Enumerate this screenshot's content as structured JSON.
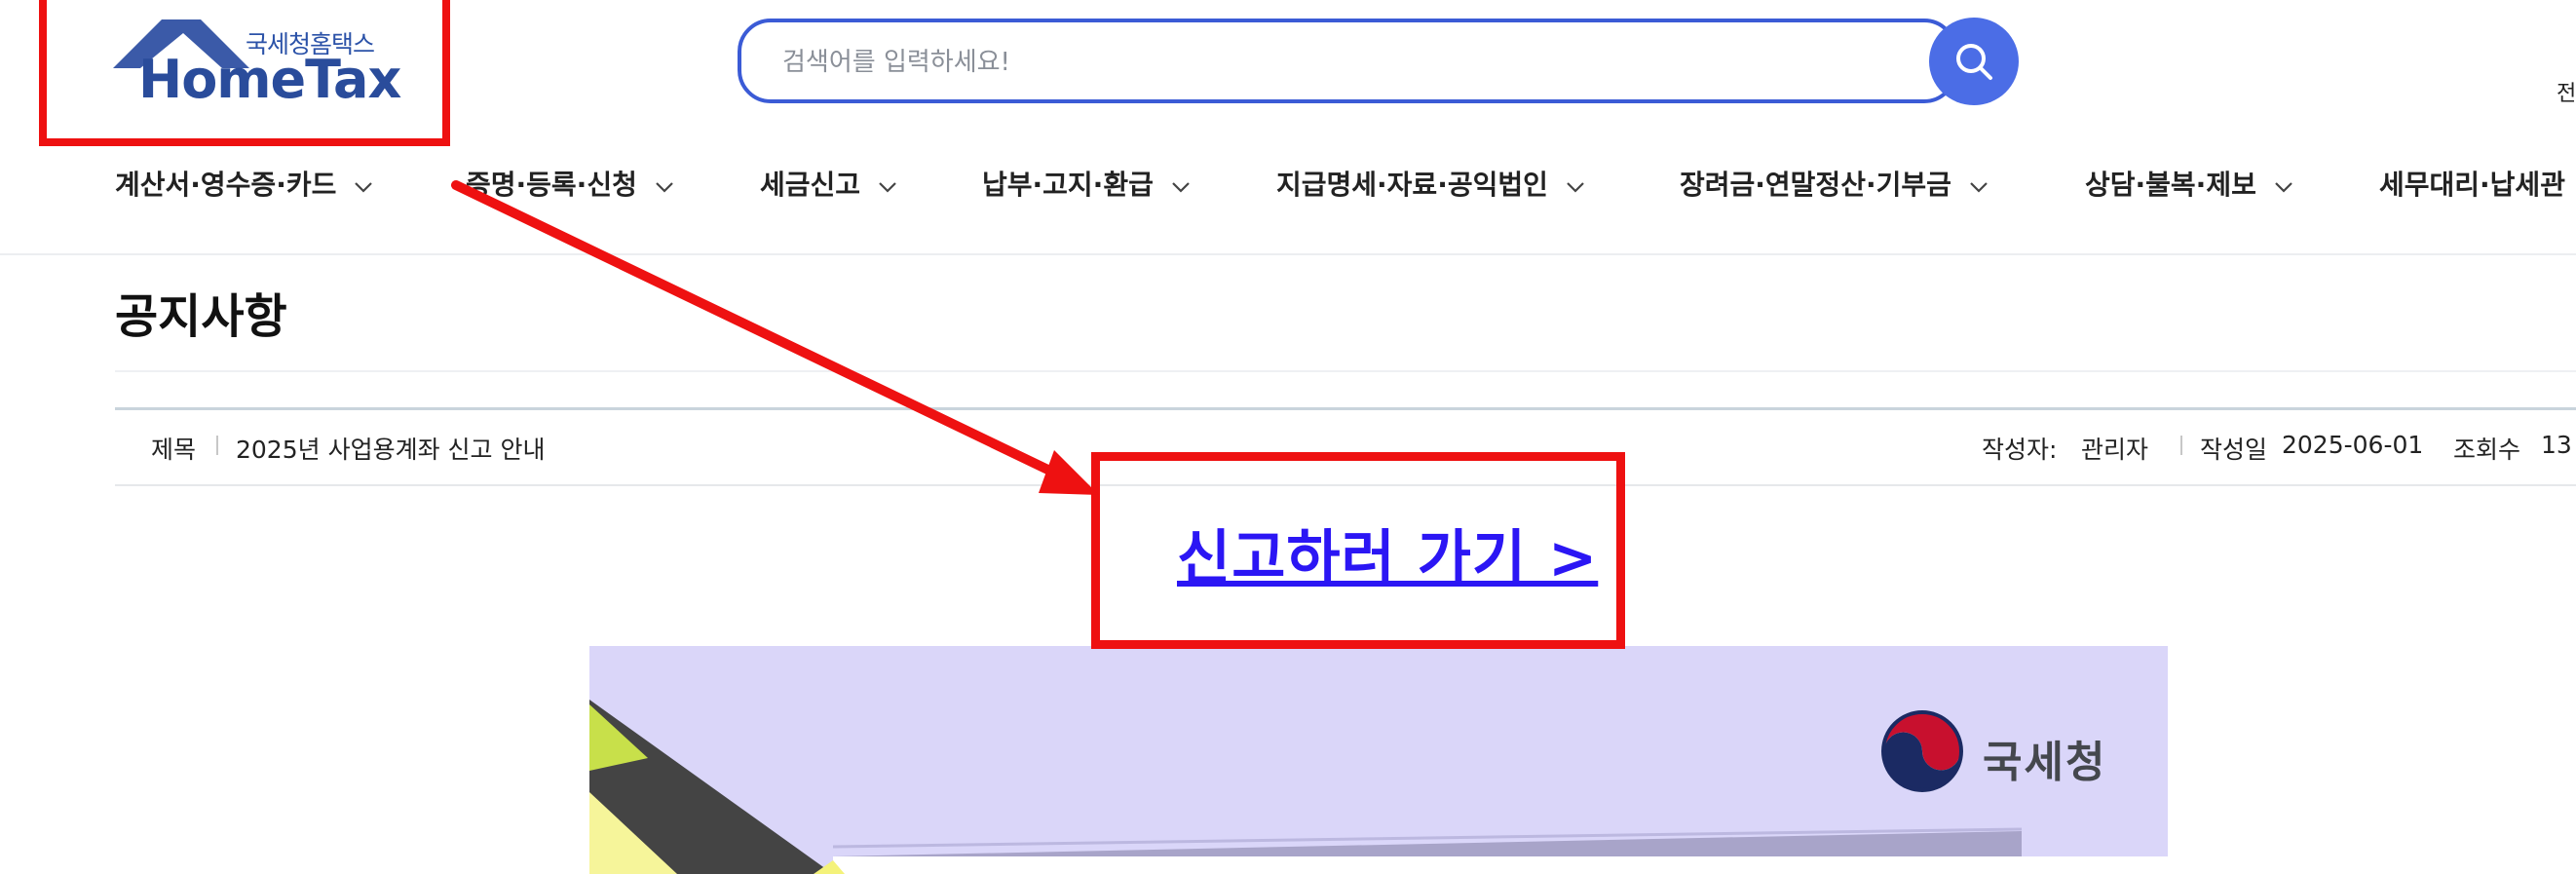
{
  "logo": {
    "korean": "국세청홈택스",
    "english": "HomeTax"
  },
  "search": {
    "placeholder": "검색어를 입력하세요!",
    "value": ""
  },
  "header_edge_text": "전",
  "nav": {
    "items": [
      {
        "label": "계산서·영수증·카드"
      },
      {
        "label": "증명·등록·신청"
      },
      {
        "label": "세금신고"
      },
      {
        "label": "납부·고지·환급"
      },
      {
        "label": "지급명세·자료·공익법인"
      },
      {
        "label": "장려금·연말정산·기부금"
      },
      {
        "label": "상담·불복·제보"
      },
      {
        "label": "세무대리·납세관"
      }
    ]
  },
  "page": {
    "title": "공지사항",
    "subject_label": "제목",
    "subject": "2025년 사업용계좌 신고 안내",
    "author_label": "작성자:",
    "author": "관리자",
    "date_label": "작성일",
    "date": "2025-06-01",
    "views_label": "조회수",
    "views": "13"
  },
  "link": {
    "label": "신고하러 가기 >"
  },
  "banner": {
    "agency": "국세청"
  },
  "colors": {
    "annotation_red": "#ee1111",
    "search_border": "#3b5bd6",
    "search_button": "#4b6de6",
    "link_blue": "#2b16f4",
    "banner_bg": "#dad6f9"
  }
}
